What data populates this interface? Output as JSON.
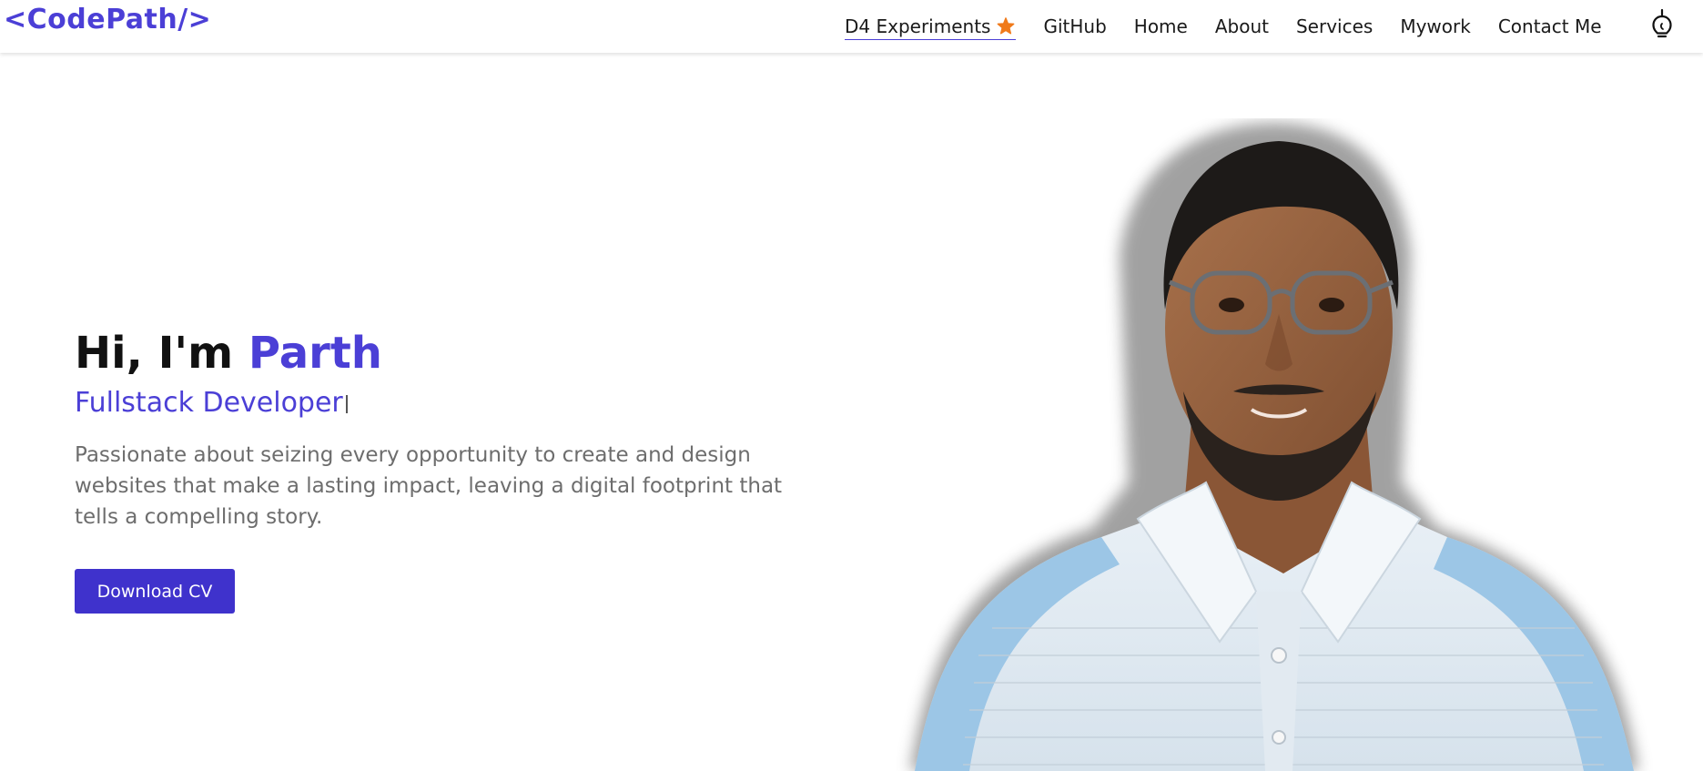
{
  "header": {
    "logo": "<CodePath/>",
    "nav": [
      {
        "label": "D4 Experiments",
        "active": true
      },
      {
        "label": "GitHub"
      },
      {
        "label": "Home"
      },
      {
        "label": "About"
      },
      {
        "label": "Services"
      },
      {
        "label": "Mywork"
      },
      {
        "label": "Contact Me"
      }
    ],
    "star_icon": "star-icon",
    "theme_icon": "lightbulb-icon"
  },
  "hero": {
    "greeting": "Hi, I'm ",
    "name": "Parth",
    "role": "Fullstack Developer",
    "description": "Passionate about seizing every opportunity to create and design websites that make a lasting impact, leaving a digital footprint that tells a compelling story.",
    "cta_label": "Download CV"
  },
  "colors": {
    "accent": "#4b3fd6",
    "button": "#3f32cc",
    "star": "#f07a1a",
    "body_text": "#6d6d6d"
  }
}
